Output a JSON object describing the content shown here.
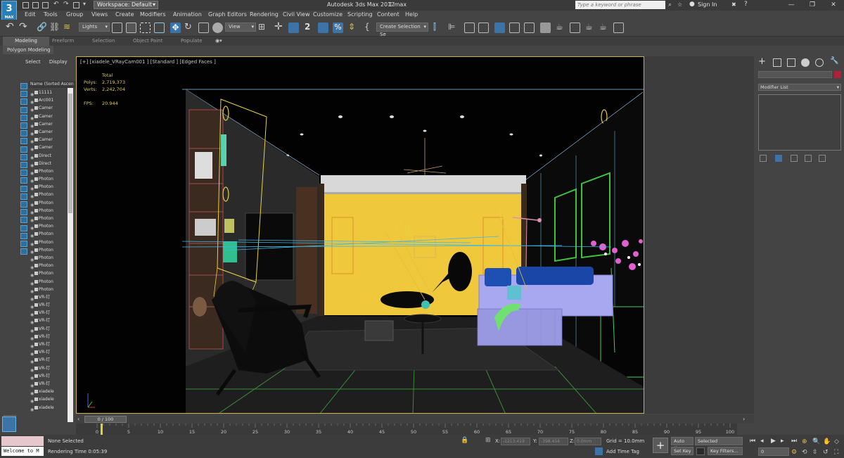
{
  "titlebar": {
    "logo": "3",
    "logo_sub": "MAX",
    "workspace": "Workspace: Default",
    "app_title": "Autodesk 3ds Max 2017",
    "file_name": "1.max",
    "search_placeholder": "Type a keyword or phrase",
    "sign_in": "Sign In",
    "minimize": "—",
    "maximize": "❐",
    "close": "✕"
  },
  "menu": [
    "Edit",
    "Tools",
    "Group",
    "Views",
    "Create",
    "Modifiers",
    "Animation",
    "Graph Editors",
    "Rendering",
    "Civil View",
    "Customize",
    "Scripting",
    "Content",
    "Help"
  ],
  "toolbar": {
    "selection_filter": "Lights",
    "ref_coord": "View",
    "selection_set": "Create Selection Se"
  },
  "ribbon": {
    "tabs": [
      "Modeling",
      "Freeform",
      "Selection",
      "Object Paint",
      "Populate"
    ],
    "active": "Modeling",
    "panel": "Polygon Modeling"
  },
  "explorer": {
    "tabs": [
      "Select",
      "Display"
    ],
    "header": "Name (Sorted Ascen",
    "items": [
      "11111",
      "Arc001",
      "Camer",
      "Camer",
      "Camer",
      "Camer",
      "Camer",
      "Camer",
      "Direct",
      "Direct",
      "Photon",
      "Photon",
      "Photon",
      "Photon",
      "Photon",
      "Photon",
      "Photon",
      "Photon",
      "Photon",
      "Photon",
      "Photon",
      "Photon",
      "Photon",
      "Photon",
      "Photon",
      "Photon",
      "VR-灯",
      "VR-灯",
      "VR-灯",
      "VR-灯",
      "VR-灯",
      "VR-灯",
      "VR-灯",
      "VR-灯",
      "VR-灯",
      "VR-灯",
      "VR-灯",
      "VR-灯",
      "xiadele",
      "xiadele",
      "xiadele"
    ]
  },
  "viewport": {
    "label": "[+] [xiadele_VRayCam001 ] [Standard ] [Edged Faces ]",
    "stats_title": "Total",
    "polys_label": "Polys:",
    "polys": "2,719,373",
    "verts_label": "Verts:",
    "verts": "2,242,704",
    "fps_label": "FPS:",
    "fps": "20.944"
  },
  "command_panel": {
    "modifier_list": "Modifier List"
  },
  "timeline": {
    "slider": "0 / 100",
    "ticks": [
      "0",
      "5",
      "10",
      "15",
      "20",
      "25",
      "30",
      "35",
      "40",
      "45",
      "50",
      "55",
      "60",
      "65",
      "70",
      "75",
      "80",
      "85",
      "90",
      "95",
      "100"
    ]
  },
  "status": {
    "listener": "Welcome to M",
    "selection": "None Selected",
    "render_time": "Rendering Time  0:05:39",
    "x_label": "X:",
    "x_value": "-1213.419",
    "y_label": "Y:",
    "y_value": "-398.454",
    "z_label": "Z:",
    "z_value": "0.0mm",
    "grid": "Grid = 10.0mm",
    "add_time_tag": "Add Time Tag",
    "auto_key": "Auto Key",
    "selected": "Selected",
    "set_key": "Set Key",
    "key_filters": "Key Filters...",
    "frame": "0"
  },
  "colors": {
    "viewport_border": "#c8b43c",
    "wall_yellow": "#f0c83c",
    "sofa_lavender": "#a8a8f0",
    "pillow_blue": "#1e50b4",
    "light_green": "#50e050",
    "camera_yellow": "#e8d040",
    "flower_pink": "#e060d0"
  }
}
